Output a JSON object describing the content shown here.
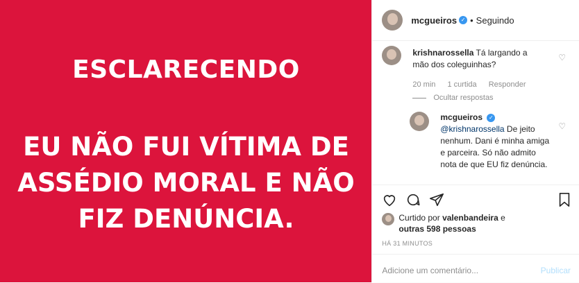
{
  "image": {
    "heading": "ESCLARECENDO",
    "lines": [
      "EU NÃO FUI VÍTIMA DE",
      "ASSÉDIO MORAL E NÃO",
      "FIZ DENÚNCIA."
    ],
    "background": "#dc143c"
  },
  "header": {
    "username": "mcgueiros",
    "dot": "•",
    "follow_status": "Seguindo"
  },
  "comments": [
    {
      "username": "krishnarossella",
      "text": "Tá largando a mão dos coleguinhas?",
      "time": "20 min",
      "likes": "1 curtida",
      "reply": "Responder",
      "hide_replies": "Ocultar respostas"
    },
    {
      "username": "mcgueiros",
      "mention": "@krishnarossella",
      "text": " De jeito nenhum. Dani é minha amiga e parceira. Só não admito nota de que EU fiz denúncia."
    }
  ],
  "likes": {
    "prefix": "Curtido por ",
    "user": "valenbandeira",
    "middle": " e",
    "others": "outras 598 pessoas"
  },
  "timestamp": "HÁ 31 MINUTOS",
  "add_comment": {
    "placeholder": "Adicione um comentário...",
    "publish": "Publicar"
  },
  "colors": {
    "accent": "#3897f0",
    "publish_disabled": "#b2dffc"
  }
}
